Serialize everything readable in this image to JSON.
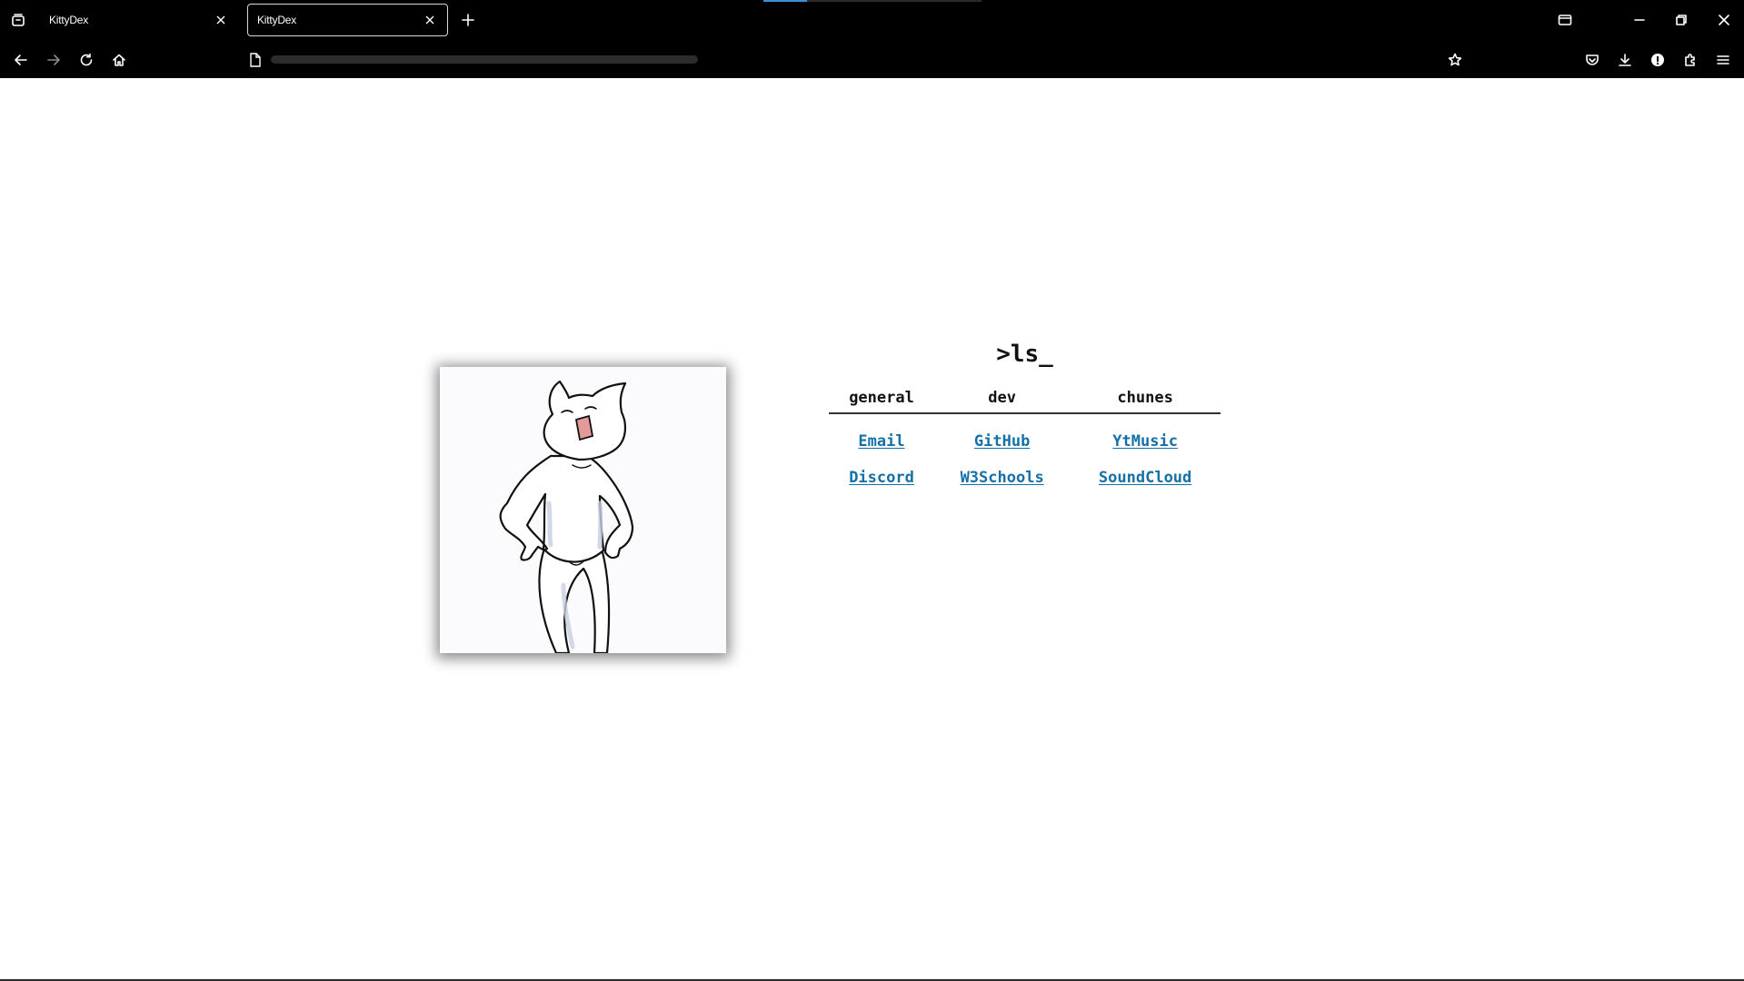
{
  "browser": {
    "tabs": [
      {
        "label": "KittyDex",
        "active": false
      },
      {
        "label": "KittyDex",
        "active": true
      }
    ],
    "icons": {
      "tab_overview": "tab-overview-icon",
      "new_tab": "plus-icon",
      "minimize": "minimize-icon",
      "restore": "restore-icon",
      "close": "close-icon",
      "back": "back-arrow-icon",
      "forward": "forward-arrow-icon",
      "reload": "reload-icon",
      "home": "home-icon",
      "bookmark": "star-icon",
      "pocket": "pocket-icon",
      "downloads": "download-icon",
      "extension_info": "info-icon",
      "extensions": "puzzle-icon",
      "menu": "hamburger-menu-icon"
    }
  },
  "page": {
    "title": ">ls_",
    "columns": [
      "general",
      "dev",
      "chunes"
    ],
    "rows": [
      [
        "Email",
        "GitHub",
        "YtMusic"
      ],
      [
        "Discord",
        "W3Schools",
        "SoundCloud"
      ]
    ],
    "link_color": "#1670a8",
    "image": "cat-illustration"
  }
}
